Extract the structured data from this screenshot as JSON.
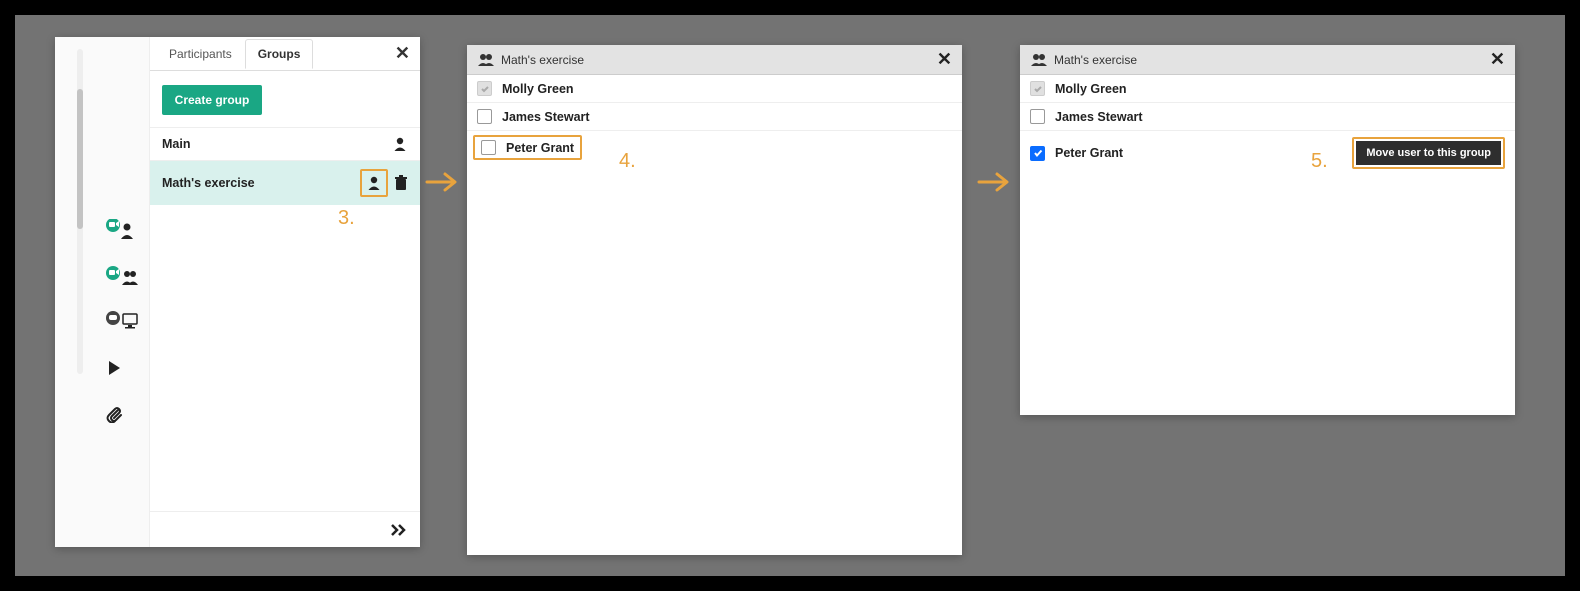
{
  "panel1": {
    "tabs": {
      "participants": "Participants",
      "groups": "Groups"
    },
    "create_btn": "Create group",
    "rows": [
      {
        "name": "Main"
      },
      {
        "name": "Math's exercise"
      }
    ]
  },
  "panel2": {
    "title": "Math's exercise",
    "users": [
      {
        "name": "Molly Green"
      },
      {
        "name": "James Stewart"
      },
      {
        "name": "Peter Grant"
      }
    ]
  },
  "panel3": {
    "title": "Math's exercise",
    "users": [
      {
        "name": "Molly Green"
      },
      {
        "name": "James Stewart"
      },
      {
        "name": "Peter Grant"
      }
    ],
    "move_btn": "Move user to this group"
  },
  "annotations": {
    "step3": "3.",
    "step4": "4.",
    "step5": "5."
  }
}
